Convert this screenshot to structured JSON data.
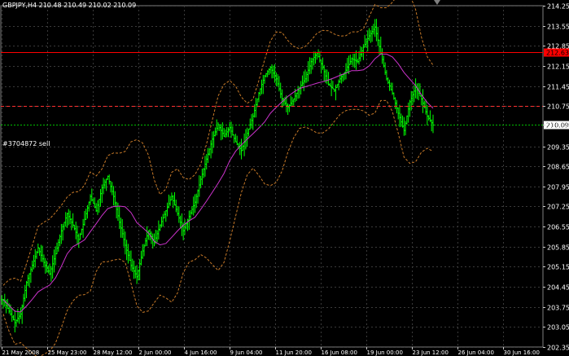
{
  "window": {
    "symbol_line": "GBPJPY,H4  210.48 210.49 210.02 210.09",
    "order_label": "#3704872 sell"
  },
  "price_scale": {
    "ticks": [
      "214.25",
      "213.55",
      "212.85",
      "212.15",
      "211.45",
      "210.75",
      "210.09",
      "209.35",
      "208.65",
      "207.95",
      "207.25",
      "206.55",
      "205.85",
      "205.15",
      "204.45",
      "203.75",
      "203.05",
      "202.35"
    ],
    "current_price": "210.09",
    "sell_level_label": "212.63"
  },
  "time_scale": {
    "ticks": [
      "21 May 2008",
      "25 May 23:00",
      "28 May 12:00",
      "2 Jun 00:00",
      "4 Jun 16:00",
      "9 Jun 04:00",
      "11 Jun 20:00",
      "16 Jun 08:00",
      "19 Jun 00:00",
      "23 Jun 12:00",
      "26 Jun 04:00",
      "30 Jun 16:00"
    ]
  },
  "colors": {
    "background": "#000000",
    "grid": "#3a3a3a",
    "bars": "#00ff00",
    "ma": "#cc33cc",
    "bands": "#c87a28",
    "sell_line": "#ff0000",
    "stop_line": "#ff3030",
    "current_line": "#00c000",
    "axis_text": "#ffffff",
    "price_tag": "#ff0000"
  },
  "chart_data": {
    "type": "line",
    "title": "GBPJPY,H4",
    "ylim": [
      202.35,
      214.25
    ],
    "series": [
      {
        "name": "GBPJPY,H4",
        "values": [
          204.0,
          203.6,
          203.2,
          203.5,
          204.6,
          205.2,
          205.8,
          205.3,
          204.9,
          205.6,
          206.4,
          207.0,
          206.6,
          206.1,
          206.8,
          207.6,
          207.1,
          207.9,
          208.3,
          207.6,
          206.7,
          205.9,
          205.2,
          204.8,
          205.7,
          206.4,
          206.0,
          206.6,
          207.1,
          207.6,
          207.0,
          206.4,
          206.9,
          207.4,
          208.2,
          208.9,
          209.6,
          210.1,
          209.7,
          210.0,
          209.5,
          209.2,
          209.8,
          210.4,
          211.2,
          211.8,
          212.1,
          211.7,
          211.0,
          210.7,
          211.0,
          211.4,
          211.7,
          212.3,
          212.6,
          212.1,
          211.5,
          211.3,
          211.7,
          212.0,
          212.4,
          212.3,
          212.8,
          213.2,
          213.5,
          212.6,
          211.7,
          211.2,
          210.5,
          209.9,
          210.9,
          211.4,
          211.0,
          210.4,
          210.09
        ]
      }
    ]
  }
}
